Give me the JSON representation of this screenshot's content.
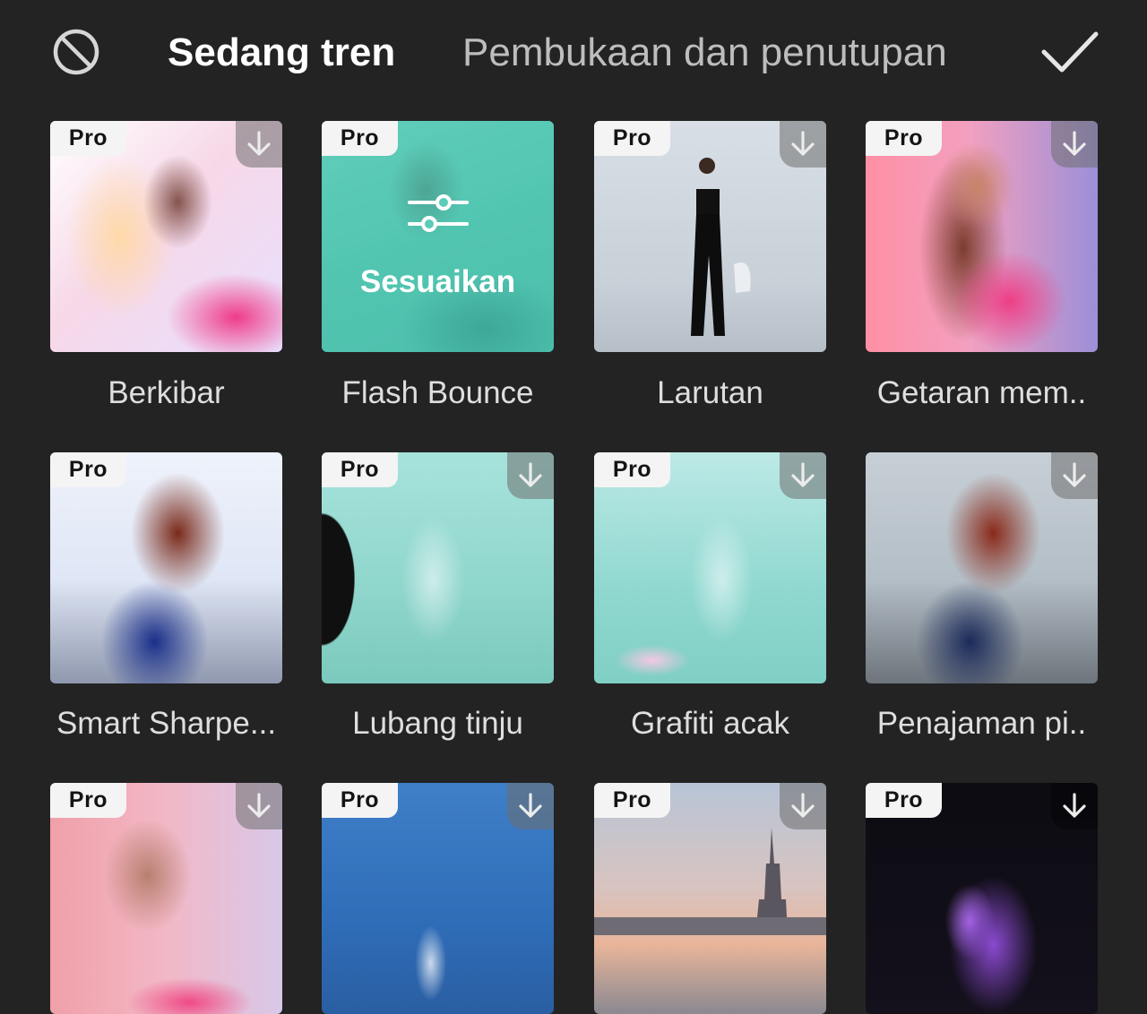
{
  "tabs": [
    {
      "label": "Sedang tren",
      "active": true
    },
    {
      "label": "Pembukaan dan penutupan",
      "active": false
    }
  ],
  "icons": {
    "none": "ban-icon",
    "confirm": "checkmark-icon",
    "download": "download-arrow-icon",
    "adjust": "sliders-icon"
  },
  "badge_label": "Pro",
  "selected_overlay_label": "Sesuaikan",
  "effects": [
    {
      "name": "Berkibar",
      "pro": true,
      "downloadable": true
    },
    {
      "name": "Flash Bounce",
      "pro": true,
      "downloadable": false,
      "selected": true
    },
    {
      "name": "Larutan",
      "pro": true,
      "downloadable": true
    },
    {
      "name": "Getaran mem..",
      "pro": true,
      "downloadable": true
    },
    {
      "name": "Smart Sharpe...",
      "pro": true,
      "downloadable": false
    },
    {
      "name": "Lubang tinju",
      "pro": true,
      "downloadable": true
    },
    {
      "name": "Grafiti acak",
      "pro": true,
      "downloadable": true
    },
    {
      "name": "Penajaman pi..",
      "pro": false,
      "downloadable": true
    },
    {
      "name": "",
      "pro": true,
      "downloadable": true
    },
    {
      "name": "",
      "pro": true,
      "downloadable": true
    },
    {
      "name": "",
      "pro": true,
      "downloadable": true
    },
    {
      "name": "",
      "pro": true,
      "downloadable": true
    }
  ],
  "colors": {
    "background": "#232323",
    "tab_active": "#ffffff",
    "tab_inactive": "#bdbdbd",
    "selected_tint": "#50c8b4"
  }
}
